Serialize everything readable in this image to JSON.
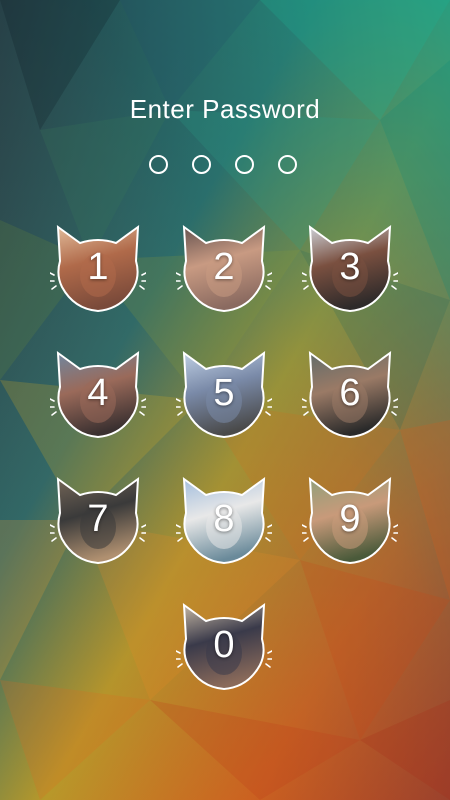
{
  "screen": {
    "title": "Enter Password",
    "entered_count": 0,
    "pin_length": 4
  },
  "keypad": {
    "keys": [
      {
        "label": "1",
        "photo_colors": [
          "#e7c5a4",
          "#b06a4a",
          "#7a4a3a"
        ]
      },
      {
        "label": "2",
        "photo_colors": [
          "#5a4a4a",
          "#c89a82",
          "#8a6a60"
        ]
      },
      {
        "label": "3",
        "photo_colors": [
          "#d8e2ec",
          "#7a5040",
          "#2e2a2a"
        ]
      },
      {
        "label": "4",
        "photo_colors": [
          "#6a8aa8",
          "#9a6a5a",
          "#3a3030"
        ]
      },
      {
        "label": "5",
        "photo_colors": [
          "#c8d8ec",
          "#7a8aa8",
          "#4a4a4a"
        ]
      },
      {
        "label": "6",
        "photo_colors": [
          "#5a6a6a",
          "#9a7a66",
          "#2a2a2a"
        ]
      },
      {
        "label": "7",
        "photo_colors": [
          "#7a6a5a",
          "#3a3a3a",
          "#b09070"
        ]
      },
      {
        "label": "8",
        "photo_colors": [
          "#9ab8dc",
          "#e8e8e8",
          "#6a8a9a"
        ]
      },
      {
        "label": "9",
        "photo_colors": [
          "#8aa07a",
          "#c89a7a",
          "#4a5a3a"
        ]
      },
      {
        "label": "0",
        "photo_colors": [
          "#d8c8b0",
          "#3a3a4a",
          "#8a6a5a"
        ]
      }
    ]
  },
  "theme": {
    "text_color": "#ffffff",
    "outline_color": "#ffffff",
    "background_palette": [
      "#1d3a48",
      "#1e8a7a",
      "#c8a12a",
      "#e0661e",
      "#b8341e"
    ]
  }
}
